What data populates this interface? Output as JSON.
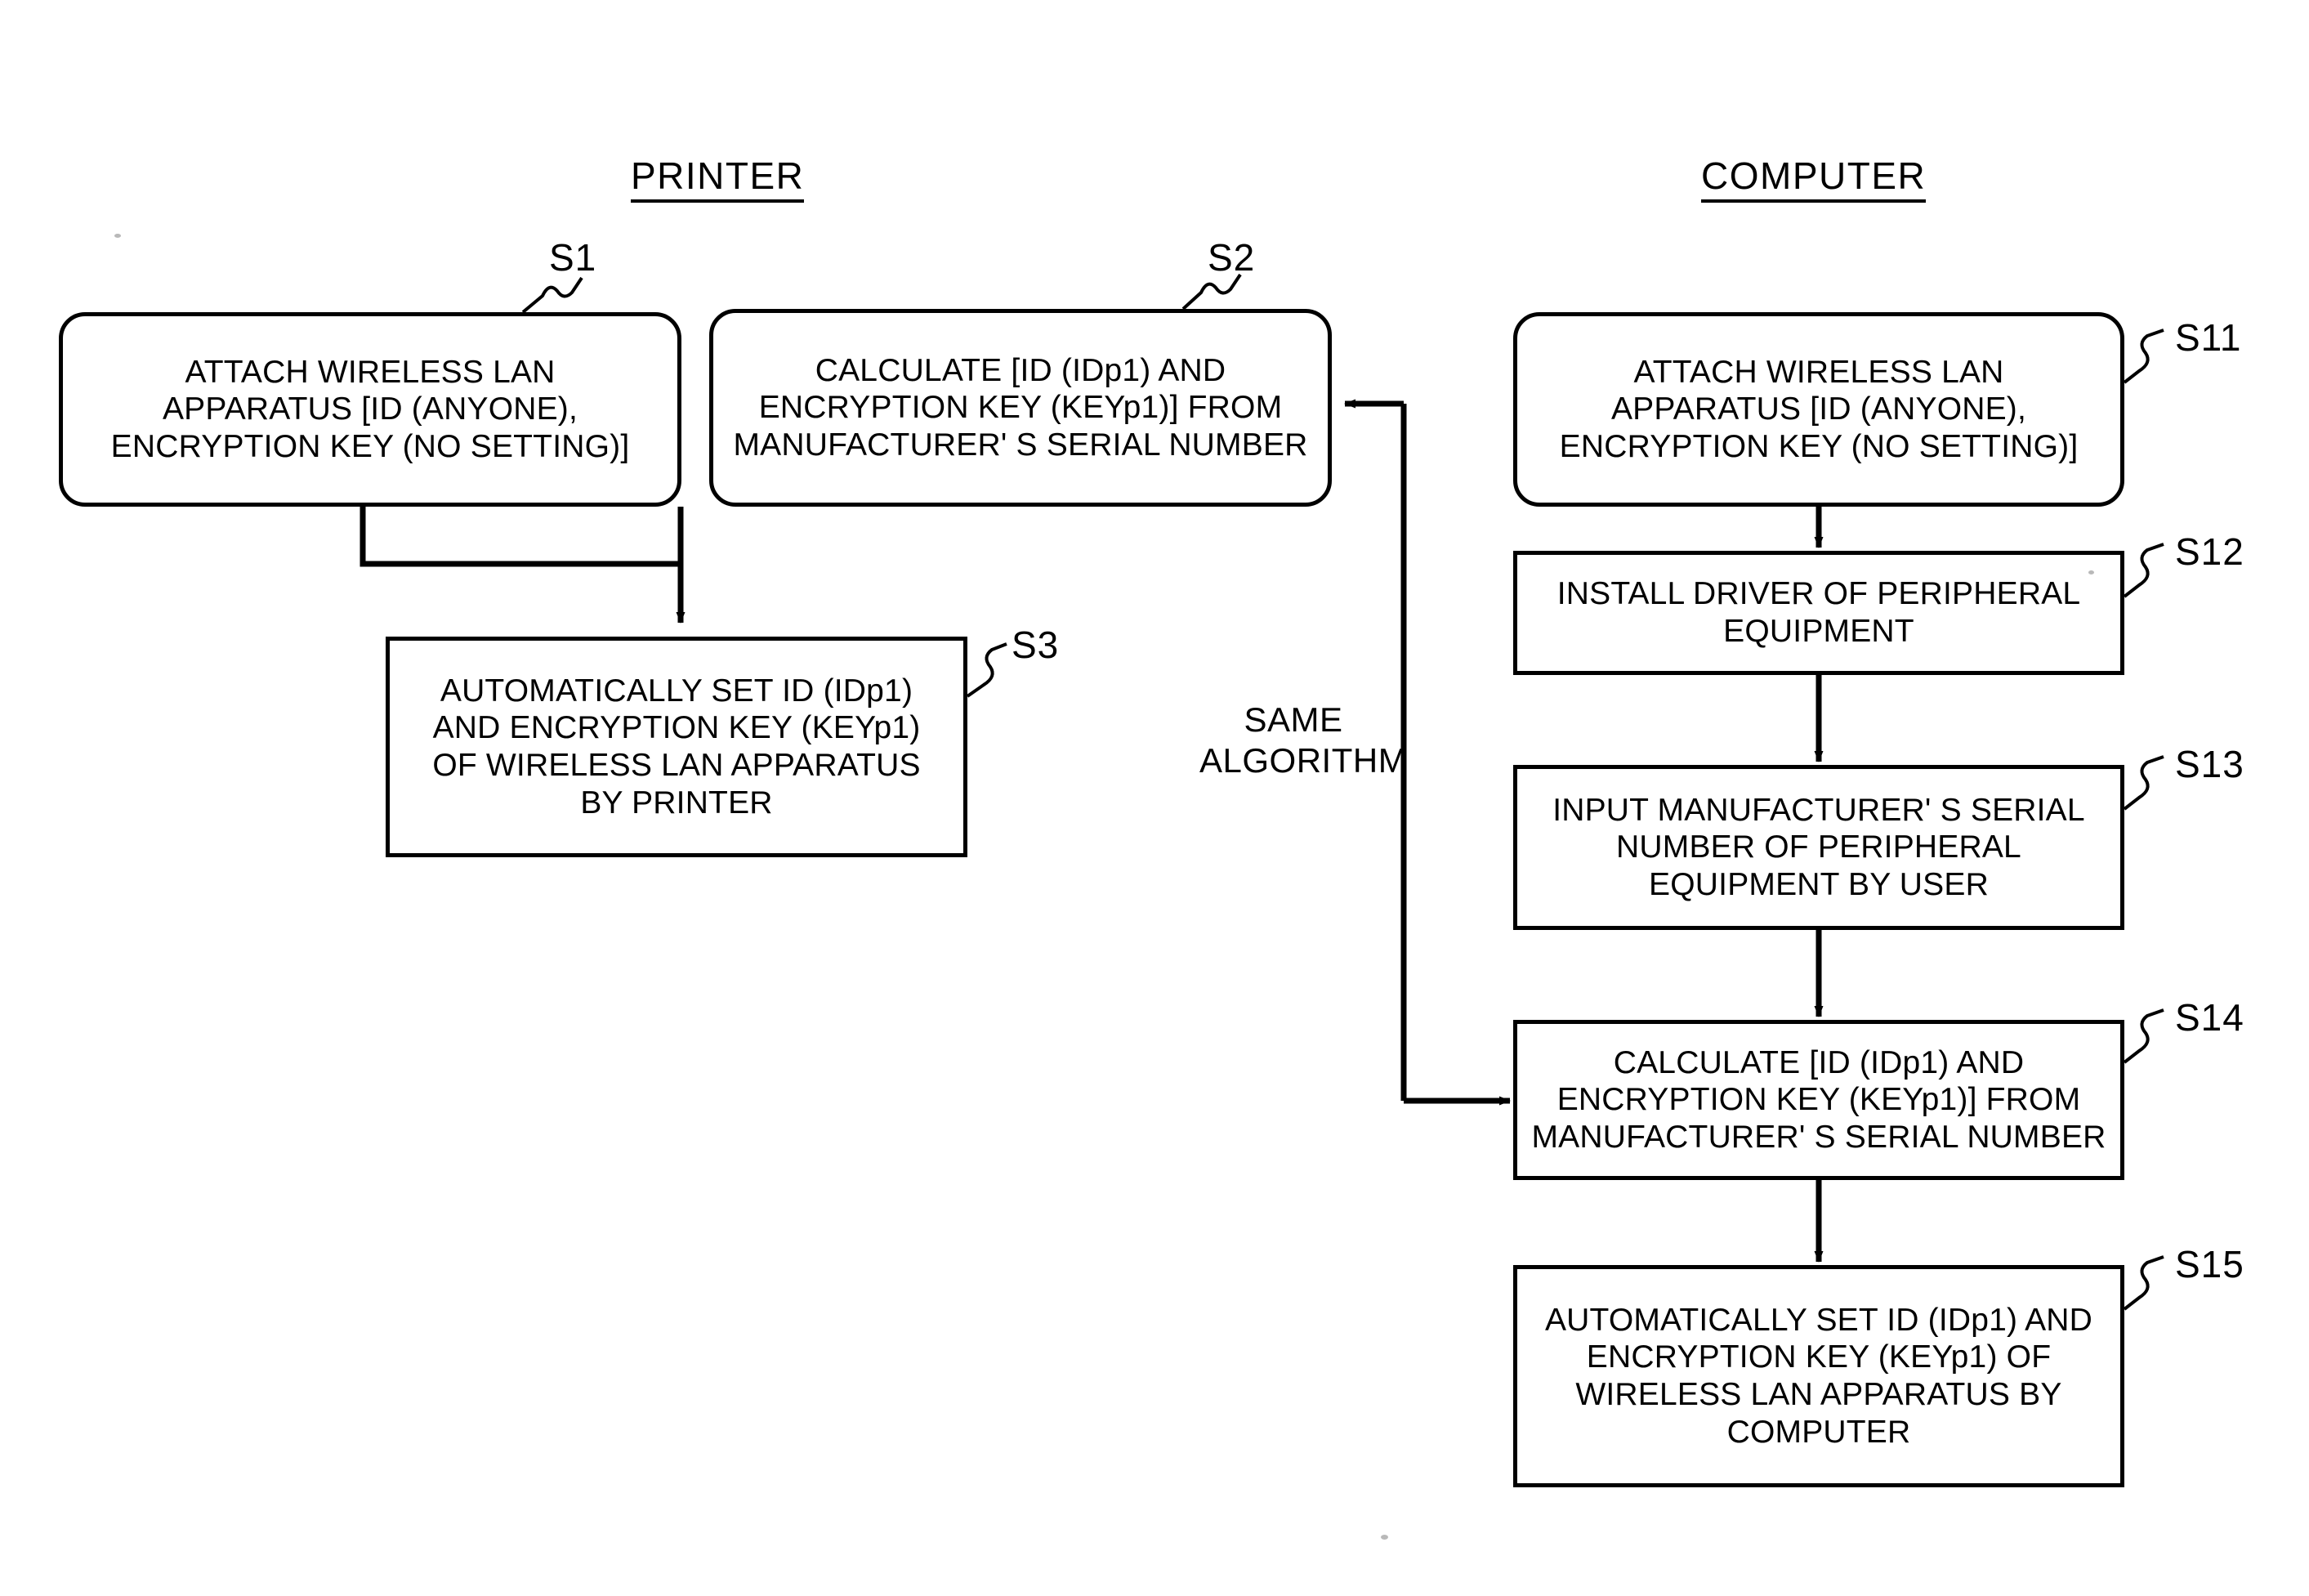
{
  "figure": {
    "type": "patent-flowchart",
    "columns": [
      {
        "id": "printer",
        "title": "PRINTER"
      },
      {
        "id": "computer",
        "title": "COMPUTER"
      }
    ],
    "annotations": [
      {
        "id": "same-algorithm",
        "text": "SAME\nALGORITHM"
      }
    ],
    "boxes": [
      {
        "id": "S1",
        "column": "printer",
        "shape": "rounded-rect",
        "label": "S1",
        "text": "ATTACH WIRELESS LAN\nAPPARATUS [ID (ANYONE),\nENCRYPTION KEY (NO SETTING)]"
      },
      {
        "id": "S2",
        "column": "printer",
        "shape": "rounded-rect",
        "label": "S2",
        "text": "CALCULATE [ID (IDp1) AND\nENCRYPTION KEY (KEYp1)] FROM\nMANUFACTURER' S SERIAL NUMBER"
      },
      {
        "id": "S3",
        "column": "printer",
        "shape": "rect",
        "label": "S3",
        "text": "AUTOMATICALLY SET ID (IDp1)\nAND ENCRYPTION KEY (KEYp1)\nOF WIRELESS LAN APPARATUS\nBY PRINTER"
      },
      {
        "id": "S11",
        "column": "computer",
        "shape": "rounded-rect",
        "label": "S11",
        "text": "ATTACH WIRELESS LAN\nAPPARATUS [ID (ANYONE),\nENCRYPTION KEY (NO SETTING)]"
      },
      {
        "id": "S12",
        "column": "computer",
        "shape": "rect",
        "label": "S12",
        "text": "INSTALL DRIVER OF PERIPHERAL\nEQUIPMENT"
      },
      {
        "id": "S13",
        "column": "computer",
        "shape": "rect",
        "label": "S13",
        "text": "INPUT MANUFACTURER' S SERIAL\nNUMBER OF PERIPHERAL\nEQUIPMENT BY USER"
      },
      {
        "id": "S14",
        "column": "computer",
        "shape": "rect",
        "label": "S14",
        "text": "CALCULATE [ID (IDp1) AND\nENCRYPTION KEY (KEYp1)] FROM\nMANUFACTURER' S SERIAL NUMBER"
      },
      {
        "id": "S15",
        "column": "computer",
        "shape": "rect",
        "label": "S15",
        "text": "AUTOMATICALLY SET ID (IDp1) AND\nENCRYPTION KEY (KEYp1) OF\nWIRELESS LAN  APPARATUS BY\nCOMPUTER"
      }
    ],
    "connectors": [
      {
        "from": "S1",
        "to": "S3",
        "style": "elbow-down-right",
        "arrow": true
      },
      {
        "from": "S2",
        "to": "S3",
        "style": "straight-down",
        "arrow": true
      },
      {
        "from": "S11",
        "to": "S12",
        "style": "straight-down",
        "arrow": true
      },
      {
        "from": "S12",
        "to": "S13",
        "style": "straight-down",
        "arrow": true
      },
      {
        "from": "S13",
        "to": "S14",
        "style": "straight-down",
        "arrow": true
      },
      {
        "from": "S14",
        "to": "S15",
        "style": "straight-down",
        "arrow": true
      },
      {
        "from": "S14",
        "to": "S2",
        "style": "bus-left-up",
        "arrow": true,
        "note": "SAME ALGORITHM"
      }
    ],
    "colors": {
      "ink": "#000000",
      "paper": "#ffffff"
    }
  }
}
